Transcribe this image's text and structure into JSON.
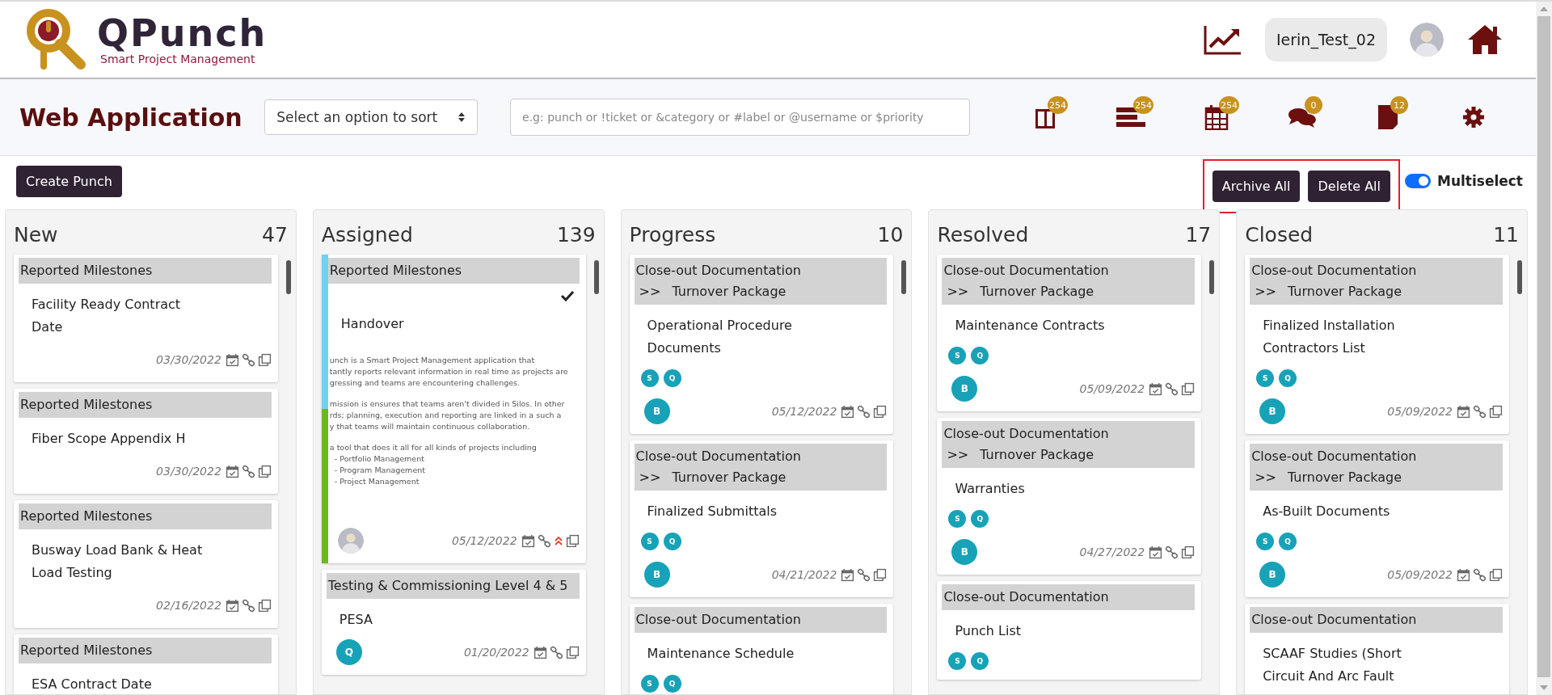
{
  "header": {
    "logo": {
      "name": "QPunch",
      "tagline": "Smart Project Management"
    },
    "username": "Ierin_Test_02"
  },
  "toolbar": {
    "title": "Web Application",
    "sort_select": {
      "value": "Select an option to sort"
    },
    "search": {
      "placeholder": "e.g: punch or !ticket or &category or #label or @username or $priority"
    },
    "view_icons": [
      {
        "kind": "board",
        "badge": "254"
      },
      {
        "kind": "list",
        "badge": "254"
      },
      {
        "kind": "calendar",
        "badge": "254"
      },
      {
        "kind": "chat",
        "badge": "0"
      },
      {
        "kind": "note",
        "badge": "12"
      },
      {
        "kind": "settings"
      }
    ]
  },
  "actions": {
    "create": "Create Punch",
    "archive": "Archive All",
    "delete": "Delete All",
    "highlighted": true,
    "multiselect": {
      "label": "Multiselect",
      "on": true
    }
  },
  "columns": [
    {
      "name": "New",
      "count": "47",
      "cards": [
        {
          "category": "Reported Milestones",
          "title": "Facility Ready Contract Date",
          "date": "03/30/2022",
          "selected": false
        },
        {
          "category": "Reported Milestones",
          "title": "Fiber Scope Appendix H",
          "date": "03/30/2022",
          "selected": false
        },
        {
          "category": "Reported Milestones",
          "title": "Busway Load Bank & Heat Load Testing",
          "date": "02/16/2022",
          "selected": false
        },
        {
          "category": "Reported Milestones",
          "title": "ESA Contract Date",
          "selected": false
        }
      ]
    },
    {
      "name": "Assigned",
      "count": "139",
      "cards": [
        {
          "category": "Reported Milestones",
          "title": "Handover",
          "selected": true,
          "stripe": [
            {
              "color": "#74d0f3"
            },
            {
              "color": "#6cb81f"
            }
          ],
          "description": [
            "unch is a Smart Project Management application that\ntantly reports relevant information in real time as projects are\ngressing and teams are encountering challenges.",
            "mission is ensures that teams aren't divided in Silos. In other\nrds; planning, execution and reporting are linked in a such a\ny that teams will maintain continuous collaboration.",
            "a tool that does it all for all kinds of projects including\n  - Portfolio Management\n  - Program Management\n  - Project Management"
          ],
          "owner": {
            "kind": "photo"
          },
          "date": "05/12/2022",
          "high_priority": true
        },
        {
          "category": "Testing & Commissioning Level 4 & 5",
          "title": "PESA",
          "selected": false,
          "owner": {
            "kind": "initial",
            "text": "Q"
          },
          "date": "01/20/2022"
        }
      ]
    },
    {
      "name": "Progress",
      "count": "10",
      "cards": [
        {
          "category": "Close-out Documentation",
          "subcategory": {
            "marker": ">>",
            "text": "Turnover Package"
          },
          "title": "Operational Procedure Documents",
          "tags": [
            "S",
            "Q"
          ],
          "owner": {
            "kind": "initial",
            "text": "B"
          },
          "date": "05/12/2022",
          "selected": false
        },
        {
          "category": "Close-out Documentation",
          "subcategory": {
            "marker": ">>",
            "text": "Turnover Package"
          },
          "title": "Finalized Submittals",
          "tags": [
            "S",
            "Q"
          ],
          "owner": {
            "kind": "initial",
            "text": "B"
          },
          "date": "04/21/2022",
          "selected": false
        },
        {
          "category": "Close-out Documentation",
          "title": "Maintenance Schedule",
          "tags": [
            "S",
            "Q"
          ],
          "selected": false
        }
      ]
    },
    {
      "name": "Resolved",
      "count": "17",
      "cards": [
        {
          "category": "Close-out Documentation",
          "subcategory": {
            "marker": ">>",
            "text": "Turnover Package"
          },
          "title": "Maintenance Contracts",
          "tags": [
            "S",
            "Q"
          ],
          "owner": {
            "kind": "initial",
            "text": "B"
          },
          "date": "05/09/2022",
          "selected": false
        },
        {
          "category": "Close-out Documentation",
          "subcategory": {
            "marker": ">>",
            "text": "Turnover Package"
          },
          "title": "Warranties",
          "tags": [
            "S",
            "Q"
          ],
          "owner": {
            "kind": "initial",
            "text": "B"
          },
          "date": "04/27/2022",
          "selected": false
        },
        {
          "category": "Close-out Documentation",
          "title": "Punch List",
          "tags": [
            "S",
            "Q"
          ],
          "selected": false
        }
      ]
    },
    {
      "name": "Closed",
      "count": "11",
      "cards": [
        {
          "category": "Close-out Documentation",
          "subcategory": {
            "marker": ">>",
            "text": "Turnover Package"
          },
          "title": "Finalized Installation Contractors List",
          "tags": [
            "S",
            "Q"
          ],
          "owner": {
            "kind": "initial",
            "text": "B"
          },
          "date": "05/09/2022",
          "selected": false
        },
        {
          "category": "Close-out Documentation",
          "subcategory": {
            "marker": ">>",
            "text": "Turnover Package"
          },
          "title": "As-Built Documents",
          "tags": [
            "S",
            "Q"
          ],
          "owner": {
            "kind": "initial",
            "text": "B"
          },
          "date": "05/09/2022",
          "selected": false
        },
        {
          "category": "Close-out Documentation",
          "title": "SCAAF Studies (Short Circuit And Arc Fault",
          "selected": false
        }
      ]
    }
  ]
}
